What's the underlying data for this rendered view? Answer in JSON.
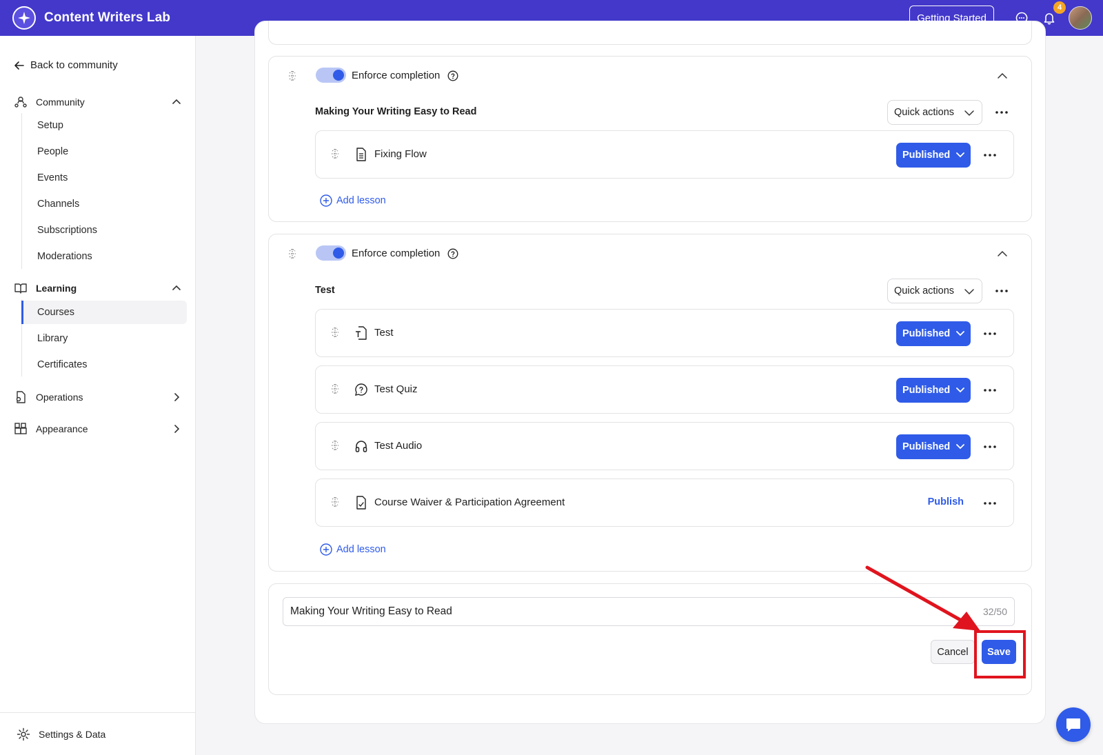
{
  "header": {
    "app_title": "Content Writers Lab",
    "getting_started": "Getting Started",
    "notification_count": "4",
    "brand_color": "#4338ca"
  },
  "sidebar": {
    "back_link": "Back to community",
    "community": {
      "label": "Community",
      "items": [
        "Setup",
        "People",
        "Events",
        "Channels",
        "Subscriptions",
        "Moderations"
      ]
    },
    "learning": {
      "label": "Learning",
      "items": [
        "Courses",
        "Library",
        "Certificates"
      ],
      "active": "Courses"
    },
    "operations": "Operations",
    "appearance": "Appearance",
    "settings": "Settings & Data"
  },
  "sections": [
    {
      "enforce_label": "Enforce completion",
      "enforce_on": true,
      "title": "Making Your Writing Easy to Read",
      "quick_actions": "Quick actions",
      "lessons": [
        {
          "title": "Fixing Flow",
          "type_icon": "document-icon",
          "status": "Published"
        }
      ],
      "add_lesson": "Add lesson"
    },
    {
      "enforce_label": "Enforce completion",
      "enforce_on": true,
      "title": "Test",
      "quick_actions": "Quick actions",
      "lessons": [
        {
          "title": "Test",
          "type_icon": "text-file-icon",
          "status": "Published"
        },
        {
          "title": "Test Quiz",
          "type_icon": "quiz-icon",
          "status": "Published"
        },
        {
          "title": "Test Audio",
          "type_icon": "headphones-icon",
          "status": "Published"
        },
        {
          "title": "Course Waiver & Participation Agreement",
          "type_icon": "signed-file-icon",
          "status": "Publish"
        }
      ],
      "add_lesson": "Add lesson"
    }
  ],
  "editor": {
    "value": "Making Your Writing Easy to Read",
    "char_count": "32/50",
    "cancel": "Cancel",
    "save": "Save"
  },
  "accent_color": "#2f5be8",
  "annotation_color": "#e0141e"
}
